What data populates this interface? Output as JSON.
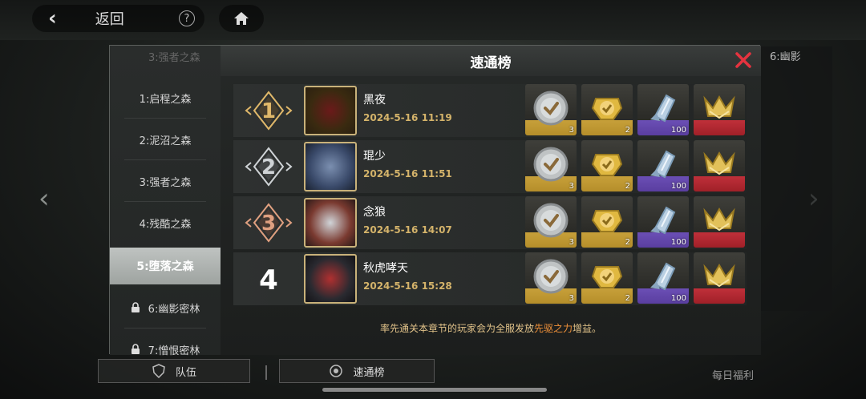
{
  "topbar": {
    "back_label": "返回",
    "help_glyph": "?"
  },
  "side_right": {
    "title": "6:幽影"
  },
  "sidebar": {
    "top_label": "3:强者之森",
    "stages": [
      {
        "label": "1:启程之森",
        "locked": false,
        "active": false
      },
      {
        "label": "2:泥沼之森",
        "locked": false,
        "active": false
      },
      {
        "label": "3:强者之森",
        "locked": false,
        "active": false
      },
      {
        "label": "4:残酷之森",
        "locked": false,
        "active": false
      },
      {
        "label": "5:堕落之森",
        "locked": false,
        "active": true
      },
      {
        "label": "6:幽影密林",
        "locked": true,
        "active": false
      },
      {
        "label": "7:憎恨密林",
        "locked": true,
        "active": false
      }
    ]
  },
  "panel": {
    "title": "速通榜",
    "footer": {
      "pre": "率先通关本章节的玩家会为全服发放",
      "highlight": "先驱之力",
      "post": "增益。"
    }
  },
  "leaderboard": [
    {
      "rank": "1",
      "name": "黑夜",
      "time": "2024-5-16 11:19",
      "rewards": [
        "3",
        "2",
        "100",
        ""
      ]
    },
    {
      "rank": "2",
      "name": "琨少",
      "time": "2024-5-16 11:51",
      "rewards": [
        "3",
        "2",
        "100",
        ""
      ]
    },
    {
      "rank": "3",
      "name": "念狼",
      "time": "2024-5-16 14:07",
      "rewards": [
        "3",
        "2",
        "100",
        ""
      ]
    },
    {
      "rank": "4",
      "name": "秋虎哮天",
      "time": "2024-5-16 15:28",
      "rewards": [
        "3",
        "2",
        "100",
        ""
      ]
    }
  ],
  "reward_types": [
    "silver-coin-icon",
    "gold-coin-icon",
    "crystal-shard-icon",
    "rank-emblem-icon"
  ],
  "bottom": {
    "team_label": "队伍",
    "speedrun_label": "速通榜",
    "daily_label": "每日福利"
  },
  "colors": {
    "accent_gold": "#d4b36a",
    "highlight_orange": "#f0913a",
    "close_red": "#e5333f"
  }
}
